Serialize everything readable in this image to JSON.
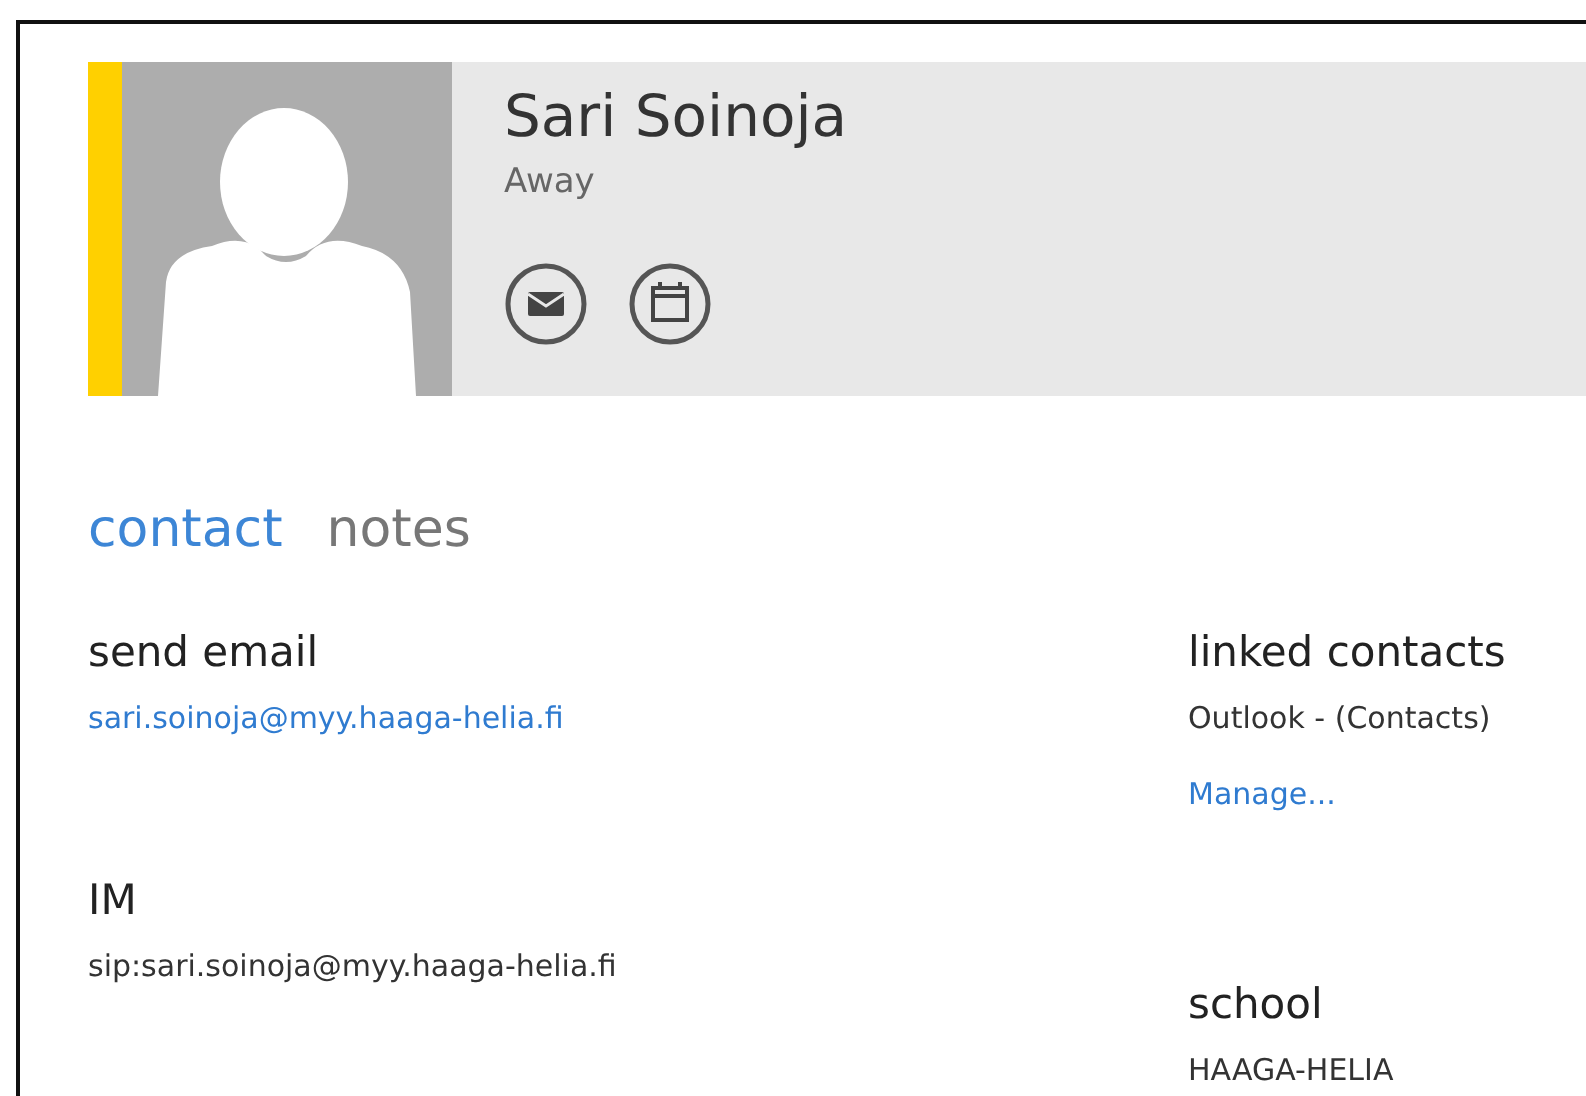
{
  "contact": {
    "name": "Sari Soinoja",
    "status": "Away",
    "away": true
  },
  "actions": [
    {
      "kind": "email"
    },
    {
      "kind": "calendar"
    }
  ],
  "tabs": [
    {
      "label": "contact",
      "selected": true
    },
    {
      "label": "notes",
      "selected": false
    }
  ],
  "columns": [
    [
      {
        "heading": "send email",
        "lines": [
          {
            "text": "sari.soinoja@myy.haaga-helia.fi",
            "kind": "link"
          }
        ]
      },
      {
        "heading": "IM",
        "lines": [
          {
            "text": "sip:sari.soinoja@myy.haaga-helia.fi",
            "kind": "text"
          }
        ]
      }
    ],
    [
      {
        "heading": "linked contacts",
        "lines": [
          {
            "text": "Outlook - (Contacts)",
            "kind": "text"
          },
          {
            "text": "Manage...",
            "kind": "link"
          }
        ]
      },
      {
        "heading": "school",
        "lines": [
          {
            "text": "HAAGA-HELIA",
            "kind": "text"
          }
        ]
      }
    ]
  ]
}
